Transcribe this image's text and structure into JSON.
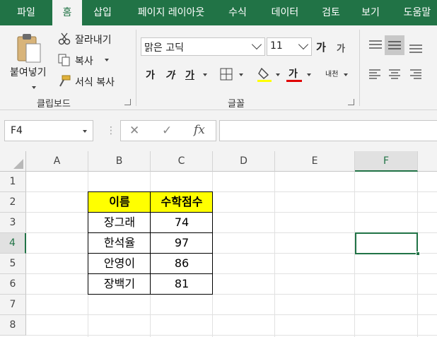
{
  "ribbon_tabs": [
    "파일",
    "홈",
    "삽입",
    "페이지 레이아웃",
    "수식",
    "데이터",
    "검토",
    "보기",
    "도움말"
  ],
  "active_tab": "홈",
  "clipboard": {
    "paste_label": "붙여넣기",
    "cut_label": "잘라내기",
    "copy_label": "복사",
    "format_painter_label": "서식 복사",
    "group_label": "클립보드"
  },
  "font": {
    "font_name": "맑은 고딕",
    "font_size": "11",
    "grow_label": "가",
    "shrink_label": "가",
    "bold_label": "가",
    "italic_label": "가",
    "underline_label": "가",
    "font_color_label": "가",
    "phonetic_label": "내천",
    "group_label": "글꼴",
    "fill_color": "#ffff00",
    "font_color": "#e00000"
  },
  "formula_bar": {
    "name_box": "F4",
    "cancel_icon": "✕",
    "enter_icon": "✓",
    "fx_label": "fx",
    "formula": ""
  },
  "columns": [
    "A",
    "B",
    "C",
    "D",
    "E",
    "F"
  ],
  "rows": [
    "1",
    "2",
    "3",
    "4",
    "5",
    "6",
    "7",
    "8"
  ],
  "selected_cell": "F4",
  "table": {
    "headers": [
      "이름",
      "수학점수"
    ],
    "rows": [
      [
        "장그래",
        "74"
      ],
      [
        "한석율",
        "97"
      ],
      [
        "안영이",
        "86"
      ],
      [
        "장백기",
        "81"
      ]
    ],
    "header_fill": "#ffff00"
  },
  "colors": {
    "accent": "#217346"
  }
}
